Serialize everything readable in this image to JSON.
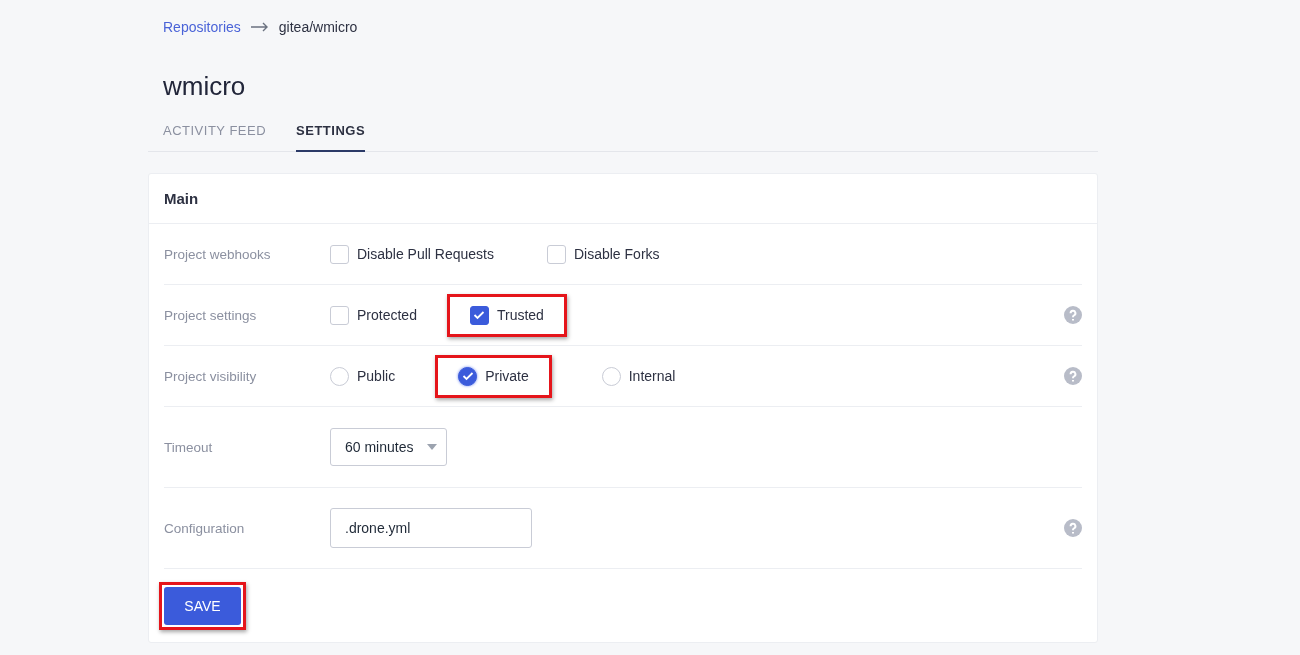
{
  "breadcrumb": {
    "link": "Repositories",
    "current": "gitea/wmicro"
  },
  "title": "wmicro",
  "tabs": [
    {
      "label": "ACTIVITY FEED",
      "selected": false
    },
    {
      "label": "SETTINGS",
      "selected": true
    }
  ],
  "section": {
    "title": "Main",
    "rows": [
      {
        "kind": "checkboxes",
        "label": "Project webhooks",
        "help": false,
        "options": [
          {
            "label": "Disable Pull Requests",
            "checked": false,
            "highlighted": false
          },
          {
            "label": "Disable Forks",
            "checked": false,
            "highlighted": false
          }
        ]
      },
      {
        "kind": "checkboxes",
        "label": "Project settings",
        "help": true,
        "options": [
          {
            "label": "Protected",
            "checked": false,
            "highlighted": false
          },
          {
            "label": "Trusted",
            "checked": true,
            "highlighted": true
          }
        ]
      },
      {
        "kind": "radios",
        "label": "Project visibility",
        "help": true,
        "options": [
          {
            "label": "Public",
            "selected": false,
            "highlighted": false
          },
          {
            "label": "Private",
            "selected": true,
            "highlighted": true
          },
          {
            "label": "Internal",
            "selected": false,
            "highlighted": false
          }
        ]
      },
      {
        "kind": "select",
        "label": "Timeout",
        "help": false,
        "value": "60 minutes"
      },
      {
        "kind": "text",
        "label": "Configuration",
        "help": true,
        "value": ".drone.yml"
      }
    ]
  },
  "save_button": {
    "label": "SAVE",
    "highlighted": true
  }
}
